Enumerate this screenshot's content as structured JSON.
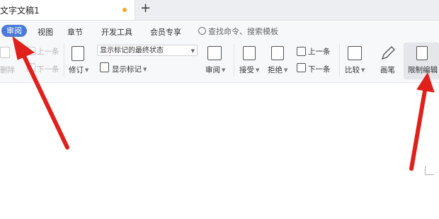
{
  "tabbar": {
    "doc_title": "文字文稿1",
    "new_tab": "+"
  },
  "menu": {
    "items": [
      "审阅",
      "视图",
      "章节",
      "开发工具",
      "会员专享"
    ],
    "active": "审阅",
    "search_label": "查找命令、搜索模板"
  },
  "ribbon": {
    "prev_left": "上一条",
    "delete": "删除",
    "next_left": "下一条",
    "track": "修订",
    "markup_select": "显示标记的最终状态",
    "show_markup": "显示标记",
    "review": "审阅",
    "accept": "接受",
    "reject": "拒绝",
    "prev": "上一条",
    "next": "下一条",
    "compare": "比较",
    "ink": "画笔",
    "restrict": "限制编辑"
  },
  "colors": {
    "accent": "#4a7bd6",
    "dot": "#f5a623",
    "arrow": "#e0201b"
  }
}
